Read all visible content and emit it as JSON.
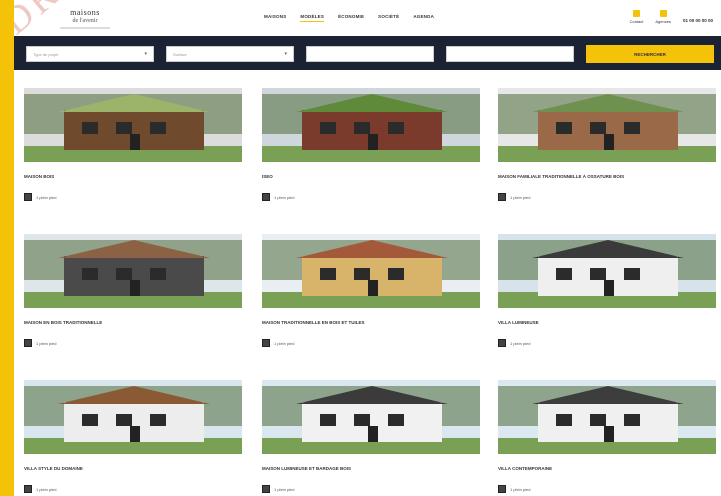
{
  "brand": {
    "name": "maisons",
    "subtitle": "de l'avenir"
  },
  "nav": {
    "items": [
      "MAISONS",
      "MODÈLES",
      "ÉCONOMIE",
      "SOCIÉTÉ",
      "AGENDA"
    ],
    "active_index": 1
  },
  "header_right": {
    "items": [
      "Contact",
      "Agences"
    ],
    "phone": "01 00 00 00 00"
  },
  "search": {
    "fields": [
      "Type de projet",
      "Surface",
      "",
      ""
    ],
    "button": "RECHERCHER"
  },
  "cards": [
    {
      "title": "MAISON BOIS",
      "meta": "1 plein pied",
      "colors": [
        "#6f4a2c",
        "#9bb46a",
        "#dcdcdc"
      ]
    },
    {
      "title": "ISEO",
      "meta": "1 plein pied",
      "colors": [
        "#7a3a2c",
        "#5f8a3a",
        "#cfd6dc"
      ]
    },
    {
      "title": "MAISON FAMILIALE TRADITIONNELLE À OSSATURE BOIS",
      "meta": "1 plein pied",
      "colors": [
        "#9a6a48",
        "#6f9150",
        "#e7e7e7"
      ]
    },
    {
      "title": "MAISON EN BOIS TRADITIONNELLE",
      "meta": "1 plein pied",
      "colors": [
        "#4a4a4a",
        "#8c6245",
        "#dfe6ea"
      ]
    },
    {
      "title": "MAISON TRADITIONNELLE EN BOIS ET TUILES",
      "meta": "1 plein pied",
      "colors": [
        "#d8b46a",
        "#a4593a",
        "#e8eef1"
      ]
    },
    {
      "title": "VILLA LUMINEUSE",
      "meta": "1 plein pied",
      "colors": [
        "#efefef",
        "#3a3a3a",
        "#d7e3ea"
      ]
    },
    {
      "title": "VILLA STYLE DU DOMAINE",
      "meta": "1 plein pied",
      "colors": [
        "#ededed",
        "#8a5a34",
        "#d9e6ee"
      ]
    },
    {
      "title": "MAISON LUMINEUSE ET BARDAGE BOIS",
      "meta": "1 plein pied",
      "colors": [
        "#f1f1f1",
        "#3b3b3b",
        "#dbe7ee"
      ]
    },
    {
      "title": "VILLA CONTEMPORAINE",
      "meta": "1 plein pied",
      "colors": [
        "#f0f0f0",
        "#3d3d3d",
        "#dce8ef"
      ]
    }
  ],
  "watermark": "DROITS D'AUTEUR"
}
